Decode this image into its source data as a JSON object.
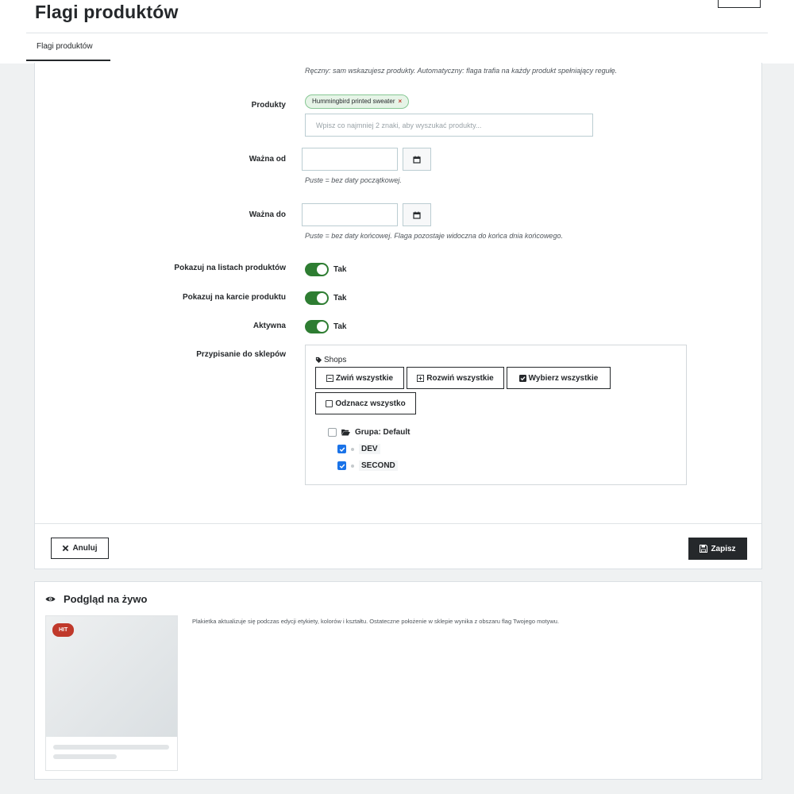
{
  "page": {
    "title": "Flagi produktów"
  },
  "tabs": [
    {
      "label": "Flagi produktów"
    }
  ],
  "form": {
    "mode_help": "Ręczny: sam wskazujesz produkty. Automatyczny: flaga trafia na każdy produkt spełniający regułę.",
    "products": {
      "label": "Produkty",
      "selected": [
        {
          "name": "Hummingbird printed sweater",
          "remove": "×"
        }
      ],
      "search_placeholder": "Wpisz co najmniej 2 znaki, aby wyszukać produkty..."
    },
    "valid_from": {
      "label": "Ważna od",
      "value": "",
      "help": "Puste = bez daty początkowej."
    },
    "valid_to": {
      "label": "Ważna do",
      "value": "",
      "help": "Puste = bez daty końcowej. Flaga pozostaje widoczna do końca dnia końcowego."
    },
    "toggles": [
      {
        "label": "Pokazuj na listach produktów",
        "value": "Tak",
        "on": true
      },
      {
        "label": "Pokazuj na karcie produktu",
        "value": "Tak",
        "on": true
      },
      {
        "label": "Aktywna",
        "value": "Tak",
        "on": true
      }
    ],
    "shops": {
      "label": "Przypisanie do sklepów",
      "title": "Shops",
      "buttons": {
        "collapse_all": "Zwiń wszystkie",
        "expand_all": "Rozwiń wszystkie",
        "select_all": "Wybierz wszystkie",
        "deselect_all": "Odznacz wszystko"
      },
      "tree": {
        "group": {
          "label": "Grupa: Default",
          "checked": false
        },
        "items": [
          {
            "label": "DEV",
            "checked": true
          },
          {
            "label": "SECOND",
            "checked": true
          }
        ]
      }
    },
    "actions": {
      "cancel": "Anuluj",
      "save": "Zapisz"
    }
  },
  "preview": {
    "title": "Podgląd na żywo",
    "description": "Plakietka aktualizuje się podczas edycji etykiety, kolorów i kształtu. Ostateczne położenie w sklepie wynika z obszaru flag Twojego motywu.",
    "badge": {
      "text": "HIT",
      "color": "#c0392b"
    }
  },
  "colors": {
    "primary": "#25282b",
    "toggle_on": "#2e7d32",
    "checkbox_on": "#1a73e8",
    "chip_bg": "#e6f4e7",
    "chip_border": "#86c793"
  }
}
